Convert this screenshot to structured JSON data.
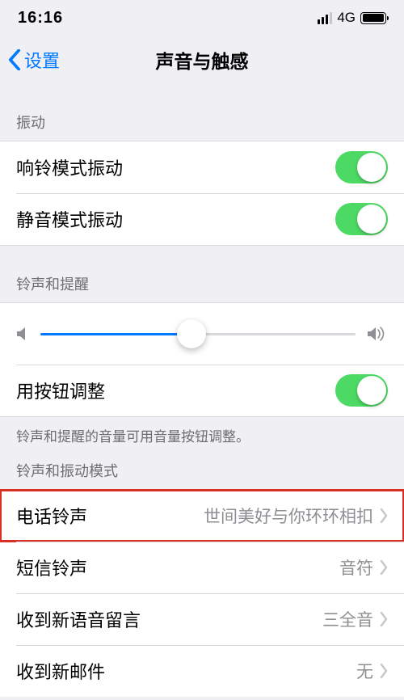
{
  "status": {
    "time": "16:16",
    "network": "4G"
  },
  "nav": {
    "back": "设置",
    "title": "声音与触感"
  },
  "sections": {
    "vibrate": {
      "header": "振动",
      "ring": "响铃模式振动",
      "silent": "静音模式振动"
    },
    "ringer": {
      "header": "铃声和提醒",
      "button_adjust": "用按钮调整",
      "footer": "铃声和提醒的音量可用音量按钮调整。",
      "slider_pct": 48
    },
    "modes": {
      "header": "铃声和振动模式",
      "ringtone": {
        "label": "电话铃声",
        "value": "世间美好与你环环相扣"
      },
      "text": {
        "label": "短信铃声",
        "value": "音符"
      },
      "voicemail": {
        "label": "收到新语音留言",
        "value": "三全音"
      },
      "mail": {
        "label": "收到新邮件",
        "value": "无"
      }
    }
  }
}
